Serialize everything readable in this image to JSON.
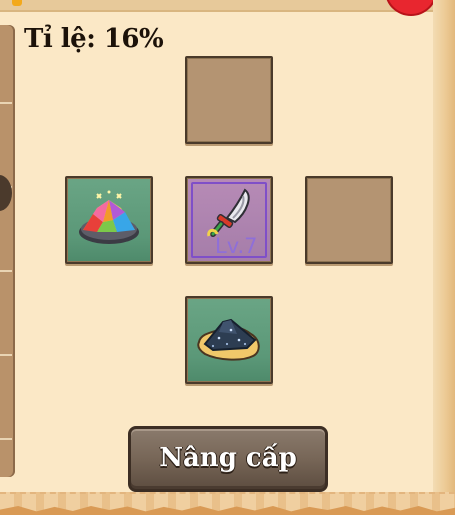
{
  "upgrade_panel": {
    "rate_label": "Tỉ lệ: 16%",
    "upgrade_button_label": "Nâng cấp"
  },
  "slots": {
    "top": {
      "state": "empty"
    },
    "left": {
      "state": "filled",
      "item_icon": "rainbow-crystal-icon"
    },
    "center": {
      "state": "filled",
      "item_icon": "sword-icon",
      "level_label": "Lv.7"
    },
    "right": {
      "state": "empty"
    },
    "bottom": {
      "state": "filled",
      "item_icon": "dark-ore-icon"
    }
  },
  "colors": {
    "panel_background": "#fbe8c6",
    "slot_empty": "#b49472",
    "slot_filled": "#5b9878",
    "slot_rare": "#a57da9",
    "level_text": "#8f6fd8",
    "button": "#776657"
  }
}
